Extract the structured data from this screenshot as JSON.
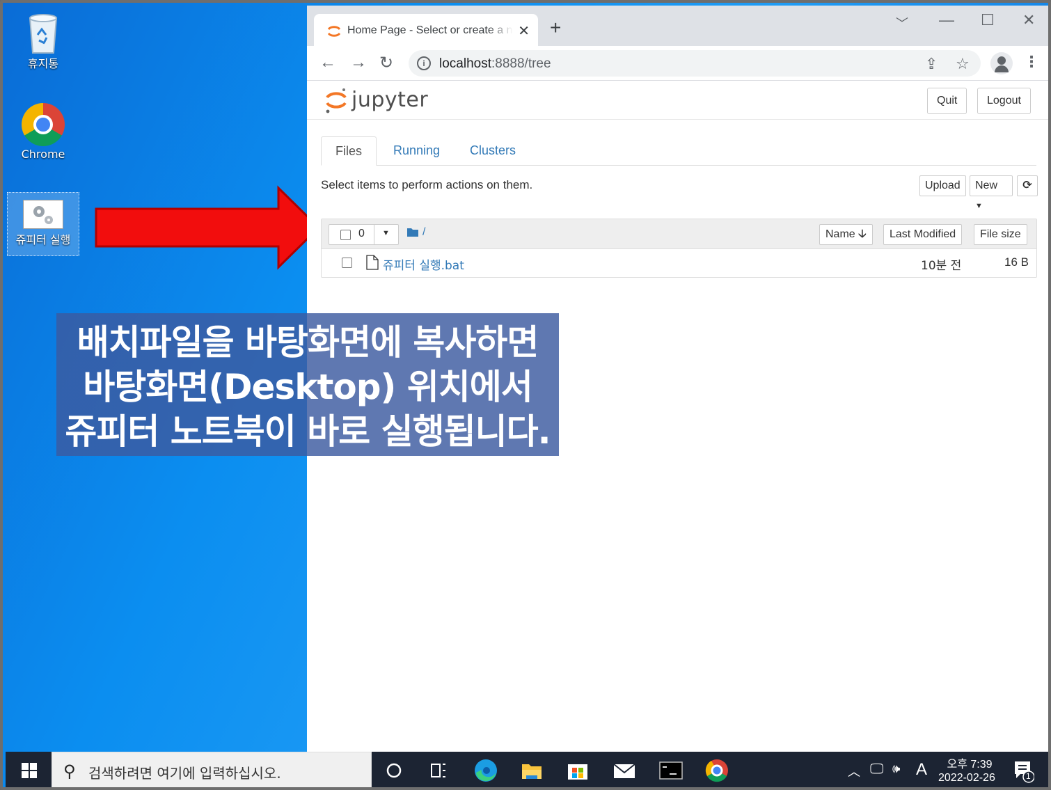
{
  "desktop": {
    "icons": [
      {
        "label": "휴지통",
        "icon": "recycle-bin-icon"
      },
      {
        "label": "Chrome",
        "icon": "chrome-icon"
      },
      {
        "label": "쥬피터 실행",
        "icon": "batch-file-gear-icon"
      }
    ]
  },
  "browser": {
    "tab_title": "Home Page - Select or create a notebook",
    "url_host": "localhost",
    "url_rest": ":8888/tree",
    "colors": {
      "titlebar": "#dee1e6",
      "accent": "#337ab7",
      "jupyter_orange": "#f37726"
    }
  },
  "jupyter": {
    "logo_text": "jupyter",
    "quit_label": "Quit",
    "logout_label": "Logout",
    "tabs": [
      {
        "label": "Files",
        "active": true
      },
      {
        "label": "Running",
        "active": false
      },
      {
        "label": "Clusters",
        "active": false
      }
    ],
    "hint": "Select items to perform actions on them.",
    "upload_label": "Upload",
    "new_label": "New",
    "selected_count": "0",
    "breadcrumb": "/",
    "columns": {
      "name": "Name",
      "modified": "Last Modified",
      "size": "File size"
    },
    "files": [
      {
        "name": "쥬피터 실행.bat",
        "modified": "10분 전",
        "size": "16 B"
      }
    ]
  },
  "caption": {
    "line1": "배치파일을 바탕화면에 복사하면",
    "line2": "바탕화면(Desktop) 위치에서",
    "line3": "쥬피터 노트북이 바로 실행됩니다."
  },
  "taskbar": {
    "search_placeholder": "검색하려면 여기에 입력하십시오.",
    "time": "오후 7:39",
    "date": "2022-02-26",
    "ime": "A",
    "notification_count": "1"
  }
}
